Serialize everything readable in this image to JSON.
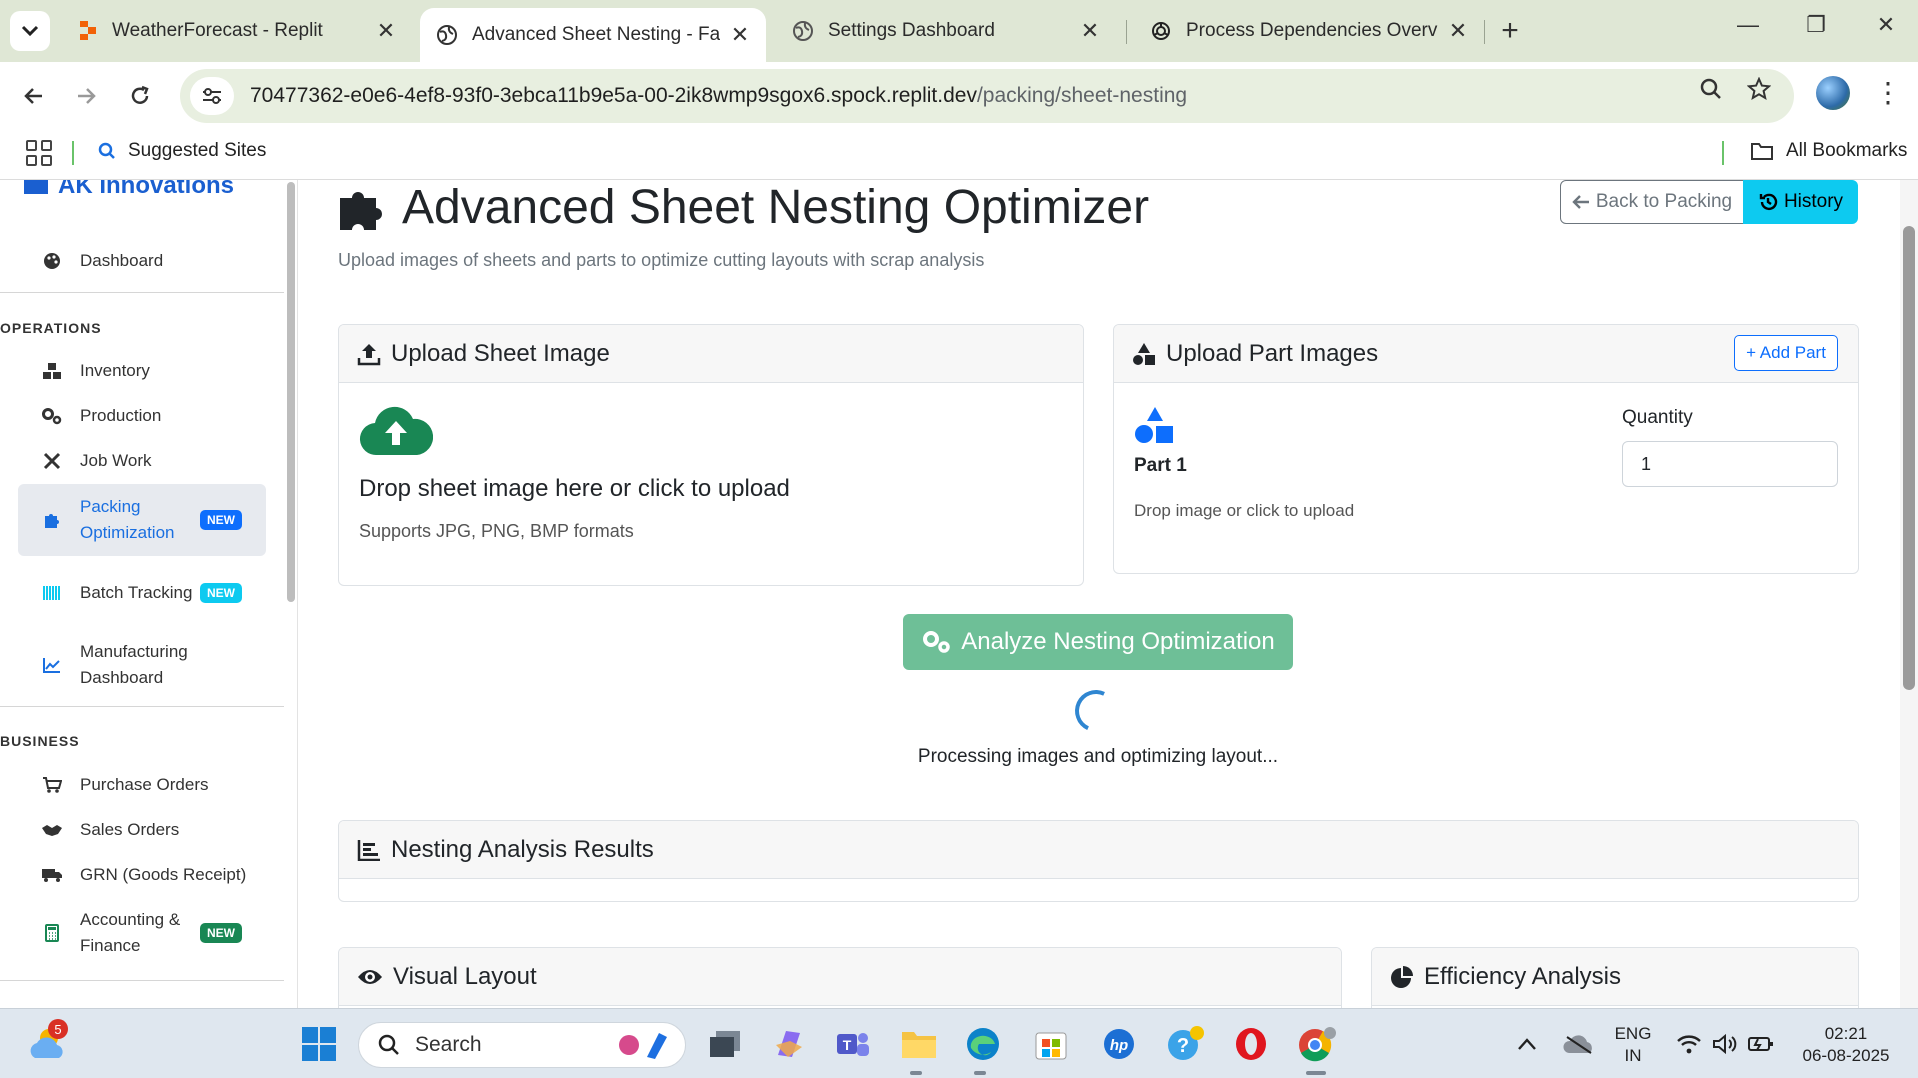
{
  "browser": {
    "tabs": [
      {
        "title": "WeatherForecast - Replit",
        "icon": "replit-icon",
        "active": false
      },
      {
        "title": "Advanced Sheet Nesting - Facto",
        "icon": "globe-icon",
        "active": true
      },
      {
        "title": "Settings Dashboard",
        "icon": "globe-icon",
        "active": false
      },
      {
        "title": "Process Dependencies Overview",
        "icon": "openai-icon",
        "active": false
      }
    ],
    "url_host": "70477362-e0e6-4ef8-93f0-3ebca11b9e5a-00-2ik8wmp9sgox6.spock.replit.dev",
    "url_path": "/packing/sheet-nesting",
    "bookmarks": {
      "suggested": "Suggested Sites",
      "all": "All Bookmarks"
    }
  },
  "sidebar": {
    "brand": "AK Innovations",
    "dashboard": "Dashboard",
    "operations_heading": "OPERATIONS",
    "operations": [
      {
        "label": "Inventory",
        "icon": "boxes-icon"
      },
      {
        "label": "Production",
        "icon": "gears-icon"
      },
      {
        "label": "Job Work",
        "icon": "tools-icon"
      },
      {
        "label": "Packing Optimization",
        "icon": "puzzle-icon",
        "badge": "NEW",
        "active": true
      },
      {
        "label": "Batch Tracking",
        "icon": "barcode-icon",
        "badge": "NEW"
      },
      {
        "label": "Manufacturing Dashboard",
        "icon": "line-chart-icon"
      }
    ],
    "business_heading": "BUSINESS",
    "business": [
      {
        "label": "Purchase Orders",
        "icon": "cart-icon"
      },
      {
        "label": "Sales Orders",
        "icon": "handshake-icon"
      },
      {
        "label": "GRN (Goods Receipt)",
        "icon": "truck-icon"
      },
      {
        "label": "Accounting & Finance",
        "icon": "calculator-icon",
        "badge": "NEW"
      }
    ]
  },
  "page": {
    "title": "Advanced Sheet Nesting Optimizer",
    "subtitle": "Upload images of sheets and parts to optimize cutting layouts with scrap analysis",
    "back_button": "Back to Packing",
    "history_button": "History"
  },
  "sheet_card": {
    "header": "Upload Sheet Image",
    "drop_title": "Drop sheet image here or click to upload",
    "drop_sub": "Supports JPG, PNG, BMP formats"
  },
  "parts_card": {
    "header": "Upload Part Images",
    "add_button": "+ Add Part",
    "part_label": "Part 1",
    "part_hint": "Drop image or click to upload",
    "quantity_label": "Quantity",
    "quantity_value": "1"
  },
  "analyze": {
    "button": "Analyze Nesting Optimization",
    "processing": "Processing images and optimizing layout..."
  },
  "results_card": {
    "header": "Nesting Analysis Results"
  },
  "visual_card": {
    "header": "Visual Layout"
  },
  "efficiency_card": {
    "header": "Efficiency Analysis"
  },
  "taskbar": {
    "search_placeholder": "Search",
    "weather_badge": "5",
    "lang_top": "ENG",
    "lang_bottom": "IN",
    "time": "02:21",
    "date": "06-08-2025"
  },
  "colors": {
    "primary": "#0d6efd",
    "info": "#0dcaf0",
    "success": "#198754",
    "analyze": "#6ebf97",
    "cloud": "#198754"
  }
}
